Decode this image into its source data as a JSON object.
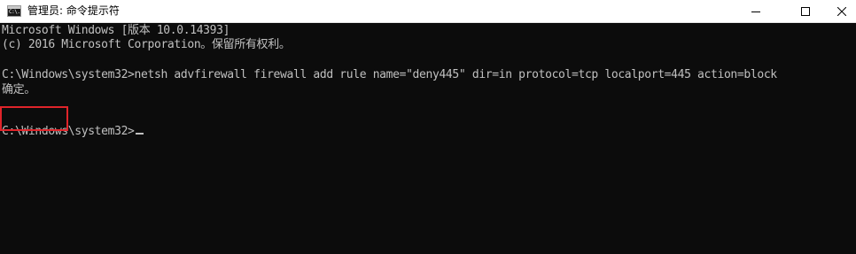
{
  "window": {
    "title": "管理员: 命令提示符",
    "icon": "cmd-icon",
    "icon_text": "C:\\."
  },
  "controls": {
    "minimize_icon": "minimize-icon",
    "maximize_icon": "maximize-icon",
    "close_icon": "close-icon"
  },
  "console": {
    "lines": [
      "Microsoft Windows [版本 10.0.14393]",
      "(c) 2016 Microsoft Corporation。保留所有权利。",
      "C:\\Windows\\system32>netsh advfirewall firewall add rule name=\"deny445\" dir=in protocol=tcp localport=445 action=block",
      "确定。",
      "C:\\Windows\\system32>"
    ],
    "text_color": "#c0c0c0",
    "background_color": "#0c0c0c",
    "highlight_color": "#e0242a"
  }
}
